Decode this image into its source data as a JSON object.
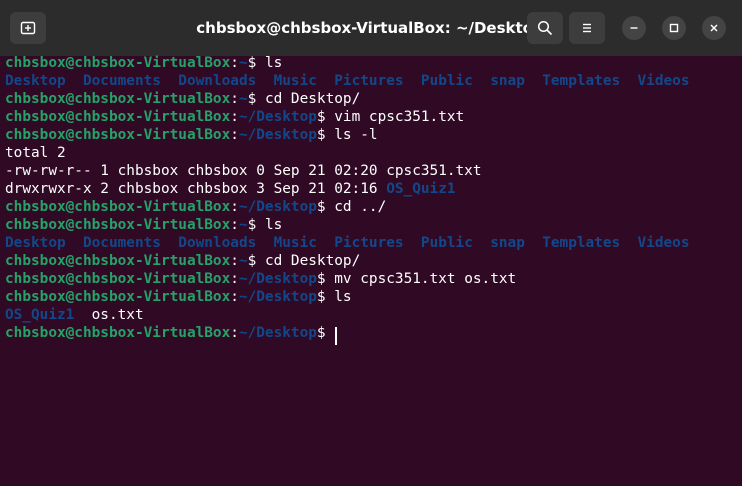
{
  "window": {
    "title": "chbsbox@chbsbox-VirtualBox: ~/Desktop",
    "buttons": {
      "new_tab_icon": "new-tab-icon",
      "search_icon": "search-icon",
      "menu_icon": "hamburger-menu-icon",
      "minimize_icon": "minimize-icon",
      "maximize_icon": "maximize-icon",
      "close_icon": "close-icon"
    }
  },
  "colors": {
    "terminal_bg": "#300a24",
    "prompt_user": "#26a269",
    "prompt_path": "#12488b",
    "directory": "#12488b",
    "text": "#ffffff",
    "titlebar": "#2c2c2c"
  },
  "terminal": {
    "prompt_user": "chbsbox@chbsbox-VirtualBox",
    "colon": ":",
    "path_home": "~",
    "path_desktop": "~/Desktop",
    "dollar": "$",
    "lines": [
      {
        "prompt": true,
        "path": "~",
        "cmd": " ls"
      },
      {
        "output": "dirs",
        "items": [
          "Desktop",
          "Documents",
          "Downloads",
          "Music",
          "Pictures",
          "Public",
          "snap",
          "Templates",
          "Videos"
        ]
      },
      {
        "prompt": true,
        "path": "~",
        "cmd": " cd Desktop/"
      },
      {
        "prompt": true,
        "path": "~/Desktop",
        "cmd": " vim cpsc351.txt"
      },
      {
        "prompt": true,
        "path": "~/Desktop",
        "cmd": " ls -l"
      },
      {
        "output": "text",
        "text": "total 2"
      },
      {
        "output": "text",
        "text": "-rw-rw-r-- 1 chbsbox chbsbox 0 Sep 21 02:20 cpsc351.txt"
      },
      {
        "output": "mixed",
        "text": "drwxrwxr-x 2 chbsbox chbsbox 3 Sep 21 02:16 ",
        "dir": "OS_Quiz1"
      },
      {
        "prompt": true,
        "path": "~/Desktop",
        "cmd": " cd ../"
      },
      {
        "prompt": true,
        "path": "~",
        "cmd": " ls"
      },
      {
        "output": "dirs",
        "items": [
          "Desktop",
          "Documents",
          "Downloads",
          "Music",
          "Pictures",
          "Public",
          "snap",
          "Templates",
          "Videos"
        ]
      },
      {
        "prompt": true,
        "path": "~",
        "cmd": " cd Desktop/"
      },
      {
        "prompt": true,
        "path": "~/Desktop",
        "cmd": " mv cpsc351.txt os.txt"
      },
      {
        "prompt": true,
        "path": "~/Desktop",
        "cmd": " ls"
      },
      {
        "output": "mixed2",
        "dir": "OS_Quiz1",
        "text": "  os.txt"
      },
      {
        "prompt": true,
        "path": "~/Desktop",
        "cmd": " ",
        "cursor": true
      }
    ]
  }
}
